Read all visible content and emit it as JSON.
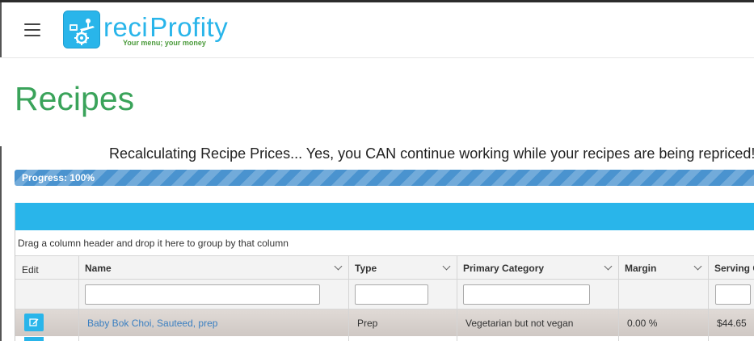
{
  "app": {
    "brand_part1": "reci",
    "brand_part2": "Profity",
    "tagline": "Your menu; your money"
  },
  "page": {
    "title": "Recipes",
    "recalc_message": "Recalculating Recipe Prices... Yes, you CAN continue working while your recipes are being repriced!",
    "progress": {
      "label": "Progress: 100%",
      "value": 100
    }
  },
  "grid": {
    "group_panel_hint": "Drag a column header and drop it here to group by that column",
    "columns": {
      "edit": "Edit",
      "name": "Name",
      "type": "Type",
      "primary_category": "Primary Category",
      "margin": "Margin",
      "serving_cost": "Serving C"
    },
    "filters": {
      "name": "",
      "type": "",
      "primary_category": "",
      "serving_cost": ""
    },
    "rows": [
      {
        "name": "Baby Bok Choi, Sauteed, prep",
        "type": "Prep",
        "primary_category": "Vegetarian but not vegan",
        "margin": "0.00 %",
        "serving_cost": "$44.65"
      }
    ]
  },
  "colors": {
    "brand_blue": "#29b5ea",
    "title_green": "#3aa35a",
    "progress_blue": "#4a93cf",
    "link_blue": "#3a7fc1"
  },
  "icons": {
    "menu": "hamburger-menu-icon",
    "logo": "chef-money-logo-icon",
    "edit": "edit-pencil-icon",
    "sort": "chevron-down-icon"
  }
}
